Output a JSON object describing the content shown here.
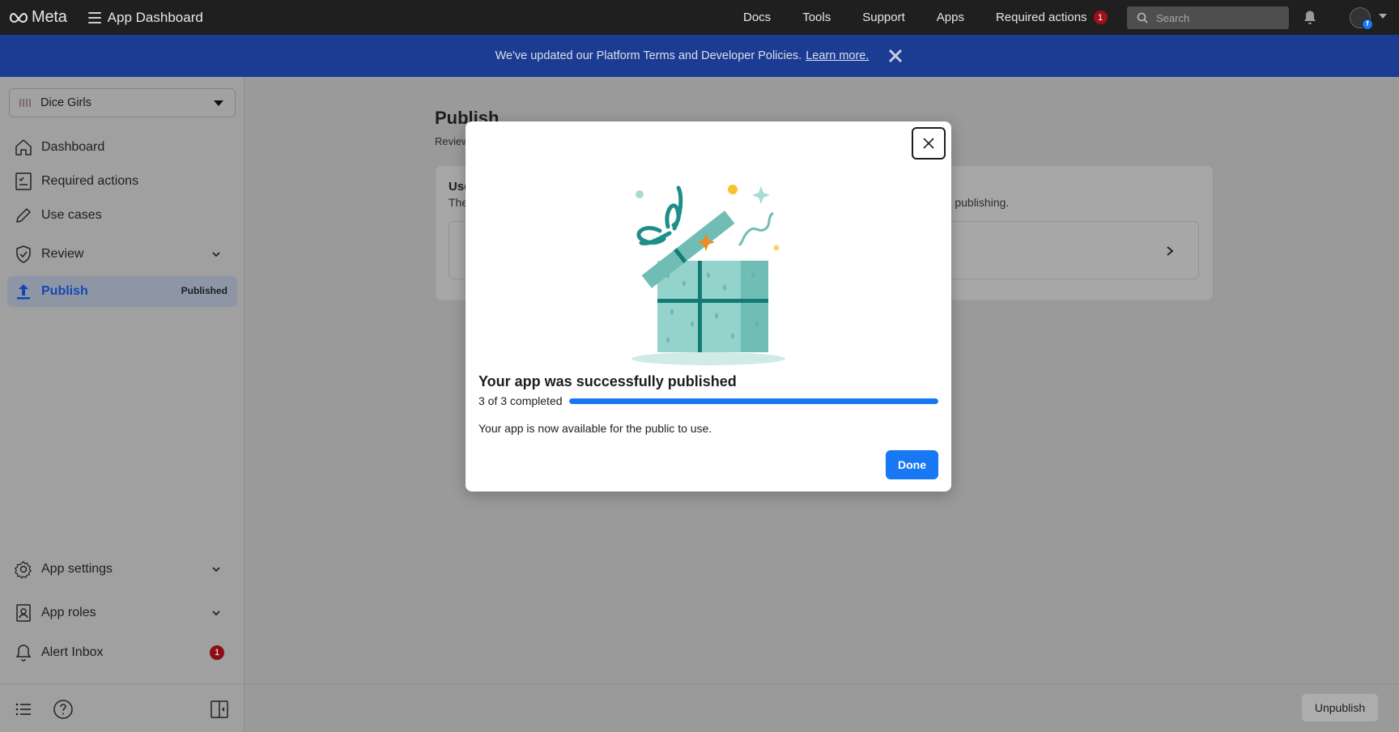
{
  "topbar": {
    "brand": "Meta",
    "app_title": "App Dashboard",
    "nav": [
      "Docs",
      "Tools",
      "Support",
      "Apps"
    ],
    "required_actions_label": "Required actions",
    "required_actions_count": "1",
    "search_placeholder": "Search"
  },
  "banner": {
    "text": "We've updated our Platform Terms and Developer Policies.",
    "link": "Learn more."
  },
  "sidebar": {
    "app_name": "Dice Girls",
    "items": [
      {
        "label": "Dashboard",
        "icon": "home-icon"
      },
      {
        "label": "Required actions",
        "icon": "checklist-icon"
      },
      {
        "label": "Use cases",
        "icon": "pencil-icon"
      },
      {
        "label": "Review",
        "icon": "shield-check-icon"
      },
      {
        "label": "Publish",
        "icon": "upload-icon",
        "badge": "Published"
      }
    ],
    "bottom_items": [
      {
        "label": "App settings",
        "icon": "gear-icon"
      },
      {
        "label": "App roles",
        "icon": "id-badge-icon"
      },
      {
        "label": "Alert Inbox",
        "icon": "bell-icon",
        "count": "1"
      }
    ]
  },
  "main": {
    "title": "Publish",
    "subtitle": "Review",
    "card_title": "Use",
    "card_desc_start": "The",
    "card_desc_end": "re publishing.",
    "unpublish_label": "Unpublish"
  },
  "modal": {
    "title": "Your app was successfully published",
    "progress_label": "3 of 3 completed",
    "progress_fraction": 1.0,
    "body": "Your app is now available for the public to use.",
    "done_label": "Done"
  },
  "colors": {
    "accent": "#1877f2",
    "banner": "#1b3c92",
    "badge_red": "#a00f1a",
    "gift_teal": "#2a9a94"
  }
}
